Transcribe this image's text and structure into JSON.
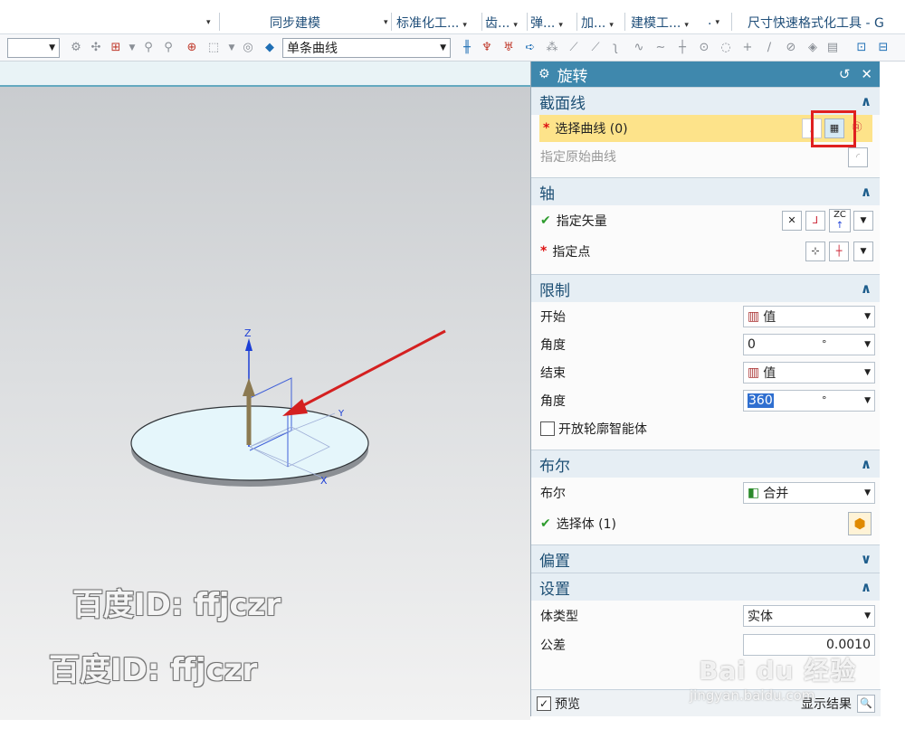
{
  "menubar": {
    "items": [
      {
        "label": "同步建模",
        "arrow": "▾"
      },
      {
        "label": "标准化工...",
        "arrow": "▾"
      },
      {
        "label": "齿...",
        "arrow": "▾"
      },
      {
        "label": "弹...",
        "arrow": "▾"
      },
      {
        "label": "加...",
        "arrow": "▾"
      },
      {
        "label": "建模工...",
        "arrow": "▾"
      },
      {
        "label": "尺寸快速格式化工具 - G",
        "arrow": ""
      }
    ]
  },
  "toolbar": {
    "curve_rule": "单条曲线"
  },
  "dialog": {
    "title": "旋转",
    "sections": {
      "section_curve": {
        "title": "截面线",
        "select_curve": "选择曲线 (0)",
        "specify_original": "指定原始曲线"
      },
      "axis": {
        "title": "轴",
        "specify_vector": "指定矢量",
        "specify_point": "指定点",
        "vector_btn": "ZC"
      },
      "limits": {
        "title": "限制",
        "start_label": "开始",
        "start_value": "值",
        "angle1_label": "角度",
        "angle1_value": "0",
        "angle1_unit": "°",
        "end_label": "结束",
        "end_value": "值",
        "angle2_label": "角度",
        "angle2_value": "360",
        "angle2_unit": "°",
        "open_profile": "开放轮廓智能体"
      },
      "boolean": {
        "title": "布尔",
        "label": "布尔",
        "value": "合并",
        "select_body": "选择体 (1)"
      },
      "offset": {
        "title": "偏置"
      },
      "settings": {
        "title": "设置",
        "body_type_label": "体类型",
        "body_type_value": "实体",
        "tolerance_label": "公差",
        "tolerance_value": "0.0010"
      }
    },
    "footer": {
      "preview": "预览",
      "show_result": "显示结果"
    }
  },
  "watermarks": {
    "line1": "百度ID: ffjczr",
    "line2": "百度ID: ffjczr",
    "baidu": "Bai du 经验",
    "baidu_url": "jingyan.baidu.com"
  },
  "axes": {
    "z": "Z",
    "x": "X",
    "y": "Y"
  },
  "colors": {
    "title_bar": "#3f88ad",
    "highlight": "#fde38a",
    "arrow": "#d42020",
    "red_box": "#e02020"
  }
}
